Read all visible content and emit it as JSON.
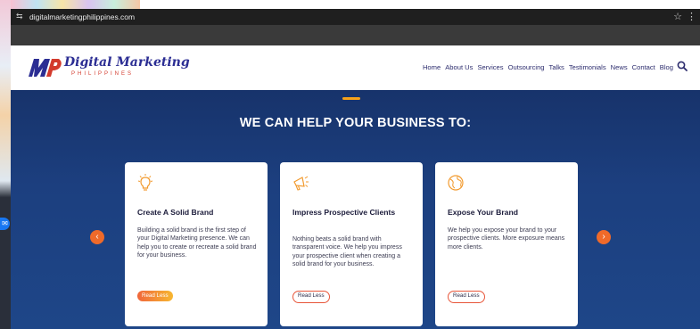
{
  "browser": {
    "url": "digitalmarketingphilippines.com"
  },
  "site": {
    "logo_text": "Digital Marketing",
    "logo_subtext": "PHILIPPINES",
    "nav": [
      "Home",
      "About Us",
      "Services",
      "Outsourcing",
      "Talks",
      "Testimonials",
      "News",
      "Contact",
      "Blog"
    ]
  },
  "hero": {
    "heading": "WE CAN HELP YOUR BUSINESS TO:"
  },
  "cards": [
    {
      "title": "Create A Solid Brand",
      "description": "Building a solid brand is the first step of your Digital Marketing presence. We can help you to create or recreate a solid brand for your business.",
      "button": "Read Less",
      "icon": "lightbulb-icon"
    },
    {
      "title": "Impress Prospective Clients",
      "description": "Nothing beats a solid brand with transparent voice. We help you impress your prospective client when creating a solid brand for your business.",
      "button": "Read Less",
      "icon": "megaphone-icon"
    },
    {
      "title": "Expose Your Brand",
      "description": "We help you expose your brand to your prospective clients. More exposure means more clients.",
      "button": "Read Less",
      "icon": "globe-icon"
    }
  ],
  "colors": {
    "hero_bg": "#1c3f7f",
    "accent": "#f6a21b",
    "arrow": "#ef6a2a",
    "nav_text": "#2d2d6e"
  }
}
